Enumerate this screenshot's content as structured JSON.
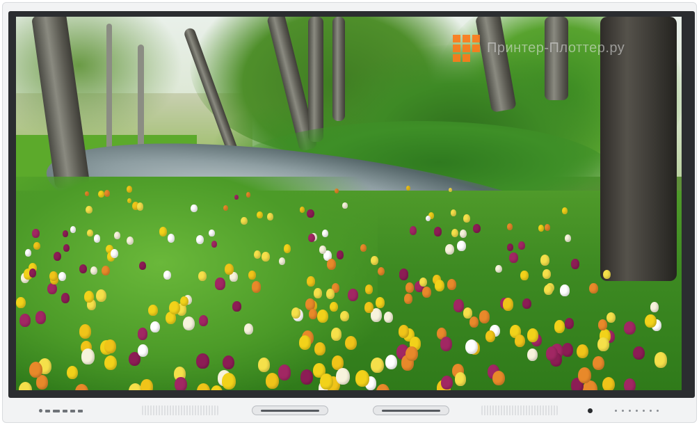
{
  "device": {
    "type": "interactive-display-panel",
    "bezel_color": "#2b2d30",
    "frame_color": "#f2f3f4"
  },
  "screen": {
    "scene": "forest-stream-with-flowers",
    "watermark": {
      "text": "Принтер-Плоттер.ру",
      "logo_color": "#ff7a1a"
    }
  },
  "bottom_bar": {
    "ports": [
      "usb-port",
      "usb-port",
      "hdmi-port",
      "usb-port",
      "usb-port",
      "audio-port"
    ],
    "handles": [
      "pen-tray-left",
      "pen-tray-right"
    ],
    "controls": [
      "power-button",
      "menu-button",
      "input-button",
      "volume-down-button",
      "volume-up-button",
      "home-button",
      "back-button",
      "eco-button"
    ]
  }
}
